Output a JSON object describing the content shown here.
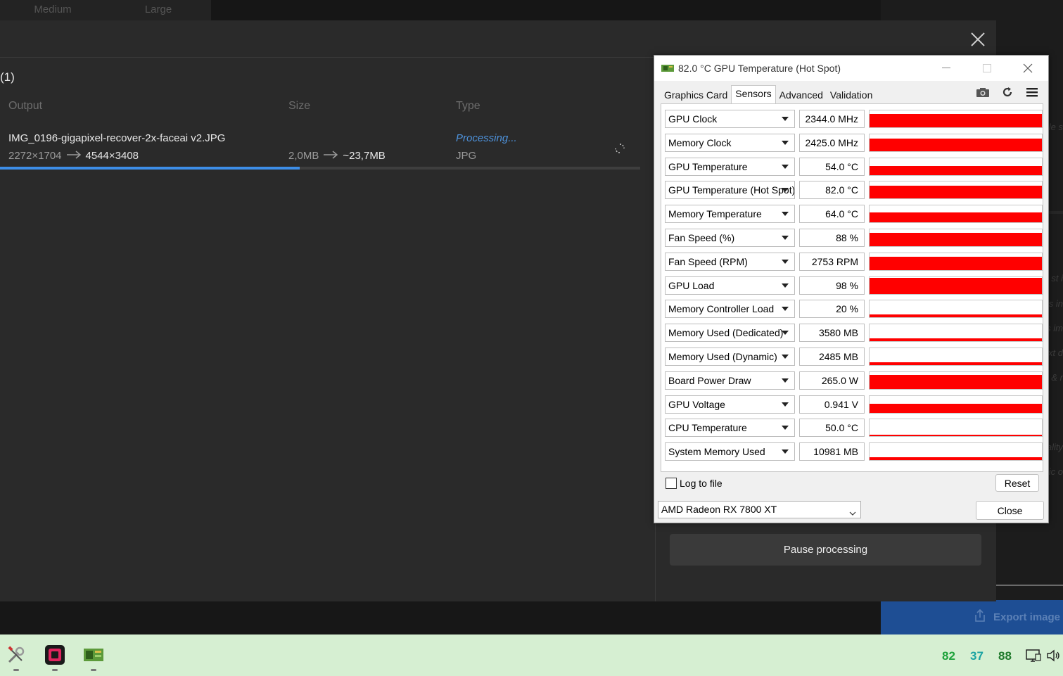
{
  "app": {
    "size_segment": [
      "Medium",
      "Large"
    ],
    "right_panel_ghost_text": [
      "le s",
      "st i",
      "s in",
      "s im",
      "xt d",
      "k & r",
      "ality",
      "ic o"
    ],
    "export_label": "Export image"
  },
  "queue": {
    "count_label": "(1)",
    "columns": {
      "output": "Output",
      "size": "Size",
      "type": "Type"
    },
    "item": {
      "filename": "IMG_0196-gigapixel-recover-2x-faceai v2.JPG",
      "res_from": "2272×1704",
      "res_to": "4544×3408",
      "size_from": "2,0MB",
      "size_to": "~23,7MB",
      "status": "Processing...",
      "type": "JPG",
      "progress_fraction": 0.468
    },
    "pause_label": "Pause processing"
  },
  "gpuz": {
    "title": "82.0 °C GPU Temperature (Hot Spot)",
    "tabs": [
      "Graphics Card",
      "Sensors",
      "Advanced",
      "Validation"
    ],
    "active_tab": "Sensors",
    "sensors": [
      {
        "name": "GPU Clock",
        "value": "2344.0 MHz",
        "level": 0.8
      },
      {
        "name": "Memory Clock",
        "value": "2425.0 MHz",
        "level": 0.75
      },
      {
        "name": "GPU Temperature",
        "value": "54.0 °C",
        "level": 0.55
      },
      {
        "name": "GPU Temperature (Hot Spot)",
        "value": "82.0 °C",
        "level": 0.75
      },
      {
        "name": "Memory Temperature",
        "value": "64.0 °C",
        "level": 0.6
      },
      {
        "name": "Fan Speed (%)",
        "value": "88 %",
        "level": 0.8
      },
      {
        "name": "Fan Speed (RPM)",
        "value": "2753 RPM",
        "level": 0.8
      },
      {
        "name": "GPU Load",
        "value": "98 %",
        "level": 0.95
      },
      {
        "name": "Memory Controller Load",
        "value": "20 %",
        "level": 0.15
      },
      {
        "name": "Memory Used (Dedicated)",
        "value": "3580 MB",
        "level": 0.18
      },
      {
        "name": "Memory Used (Dynamic)",
        "value": "2485 MB",
        "level": 0.15
      },
      {
        "name": "Board Power Draw",
        "value": "265.0 W",
        "level": 0.85
      },
      {
        "name": "GPU Voltage",
        "value": "0.941 V",
        "level": 0.55
      },
      {
        "name": "CPU Temperature",
        "value": "50.0 °C",
        "level": 0.08
      },
      {
        "name": "System Memory Used",
        "value": "10981 MB",
        "level": 0.15
      }
    ],
    "log_to_file_label": "Log to file",
    "reset_label": "Reset",
    "gpu_select_value": "AMD Radeon RX 7800 XT",
    "close_label": "Close",
    "graph_color": "#ff0000"
  },
  "taskbar": {
    "apps": [
      "tools-icon",
      "gigapixel-icon",
      "gpuz-icon"
    ],
    "tray_values": [
      {
        "value": "82",
        "color": "#1fa33c"
      },
      {
        "value": "37",
        "color": "#1aa3a3"
      },
      {
        "value": "88",
        "color": "#1f7a2c"
      }
    ]
  }
}
